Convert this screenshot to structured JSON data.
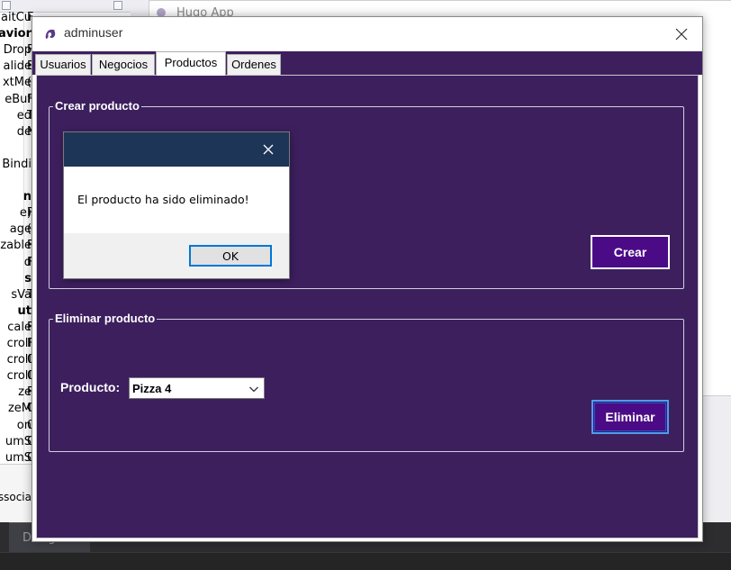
{
  "background": {
    "properties_rows": [
      {
        "name": "aitCu",
        "value": "F",
        "category": false
      },
      {
        "name": "avior",
        "value": "",
        "category": true
      },
      {
        "name": "Drop",
        "value": "F",
        "category": false
      },
      {
        "name": "alide",
        "value": "E",
        "category": false
      },
      {
        "name": "xtMe",
        "value": "(",
        "category": false
      },
      {
        "name": "eBuf",
        "value": "F",
        "category": false
      },
      {
        "name": "ed",
        "value": "T",
        "category": false
      },
      {
        "name": "de",
        "value": "N",
        "category": false
      },
      {
        "name": "",
        "value": "",
        "category": false
      },
      {
        "name": "Bindi",
        "value": "",
        "category": false
      },
      {
        "name": "",
        "value": "",
        "category": false
      },
      {
        "name": "n",
        "value": "",
        "category": true
      },
      {
        "name": "e)",
        "value": "F",
        "category": false
      },
      {
        "name": "age",
        "value": "(",
        "category": false
      },
      {
        "name": "zable",
        "value": "F",
        "category": false
      },
      {
        "name": "d",
        "value": "F",
        "category": false
      },
      {
        "name": "s",
        "value": "",
        "category": true
      },
      {
        "name": "sVa",
        "value": "T",
        "category": false
      },
      {
        "name": "ut",
        "value": "",
        "category": true
      },
      {
        "name": "cale",
        "value": "F",
        "category": false
      },
      {
        "name": "croll",
        "value": "F",
        "category": false
      },
      {
        "name": "croll",
        "value": "0",
        "category": false
      },
      {
        "name": "croll",
        "value": "0",
        "category": false
      },
      {
        "name": "ze",
        "value": "F",
        "category": false
      },
      {
        "name": "zeM",
        "value": "G",
        "category": false
      },
      {
        "name": "on",
        "value": "0",
        "category": false
      },
      {
        "name": "umS",
        "value": "0",
        "category": false
      },
      {
        "name": "umS",
        "value": "0",
        "category": false
      }
    ],
    "properties_desc": "ssocia",
    "designer_window_title": "Hugo App",
    "bottom_tab": "Designer"
  },
  "main_window": {
    "title": "adminuser",
    "tabs": [
      {
        "label": "Usuarios"
      },
      {
        "label": "Negocios"
      },
      {
        "label": "Productos"
      },
      {
        "label": "Ordenes"
      }
    ],
    "active_tab": "Productos",
    "crear_group": {
      "legend": "Crear producto",
      "button_label": "Crear"
    },
    "eliminar_group": {
      "legend": "Eliminar producto",
      "product_label": "Producto:",
      "selected_product": "Pizza 4",
      "button_label": "Eliminar"
    }
  },
  "message_box": {
    "text": "El producto ha sido eliminado!",
    "ok_label": "OK"
  },
  "colors": {
    "panel_purple": "#3d1f5e",
    "button_purple": "#4b0b86",
    "msgbox_title": "#1d3557",
    "focus_blue": "#0078d7"
  },
  "icons": {
    "app": "app-logo-icon",
    "close": "close-icon",
    "dropdown": "chevron-down-icon"
  }
}
